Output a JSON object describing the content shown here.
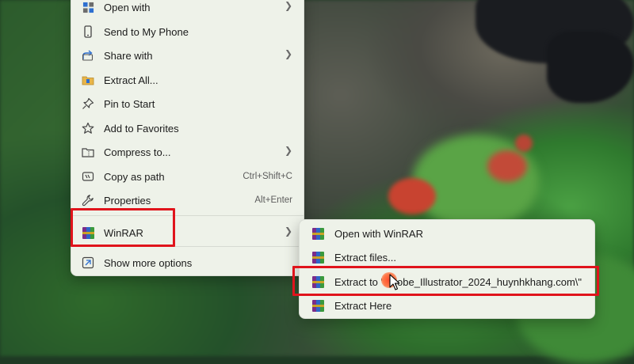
{
  "main_menu": {
    "items": [
      {
        "label": "Open with",
        "icon": "open-with-icon",
        "arrow": true
      },
      {
        "label": "Send to My Phone",
        "icon": "phone-icon"
      },
      {
        "label": "Share with",
        "icon": "share-icon",
        "arrow": true
      },
      {
        "label": "Extract All...",
        "icon": "extract-all-icon"
      },
      {
        "label": "Pin to Start",
        "icon": "pin-icon"
      },
      {
        "label": "Add to Favorites",
        "icon": "star-icon"
      },
      {
        "label": "Compress to...",
        "icon": "compress-icon",
        "arrow": true
      },
      {
        "label": "Copy as path",
        "icon": "copy-path-icon",
        "shortcut": "Ctrl+Shift+C"
      },
      {
        "label": "Properties",
        "icon": "wrench-icon",
        "shortcut": "Alt+Enter"
      },
      {
        "label": "WinRAR",
        "icon": "winrar-icon",
        "arrow": true
      },
      {
        "label": "Show more options",
        "icon": "more-options-icon"
      }
    ]
  },
  "sub_menu": {
    "items": [
      {
        "label": "Open with WinRAR",
        "icon": "winrar-icon"
      },
      {
        "label": "Extract files...",
        "icon": "winrar-icon"
      },
      {
        "label": "Extract to \"Adobe_Illustrator_2024_huynhkhang.com\\\"",
        "icon": "winrar-icon"
      },
      {
        "label": "Extract Here",
        "icon": "winrar-icon"
      }
    ]
  },
  "colors": {
    "highlight": "#e0141c",
    "menu_bg": "#eef2e9"
  }
}
